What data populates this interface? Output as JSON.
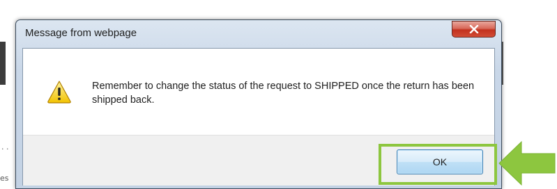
{
  "dialog": {
    "title": "Message from webpage",
    "message": "Remember to change the status of the request to SHIPPED once the return has been shipped back.",
    "ok_label": "OK",
    "icon": "warning-icon",
    "close_icon": "close-icon"
  },
  "background": {
    "fragment_dots": ". .",
    "fragment_text": "es"
  },
  "annotation": {
    "highlight_color": "#8dc63f",
    "arrow_color": "#8dc63f"
  }
}
